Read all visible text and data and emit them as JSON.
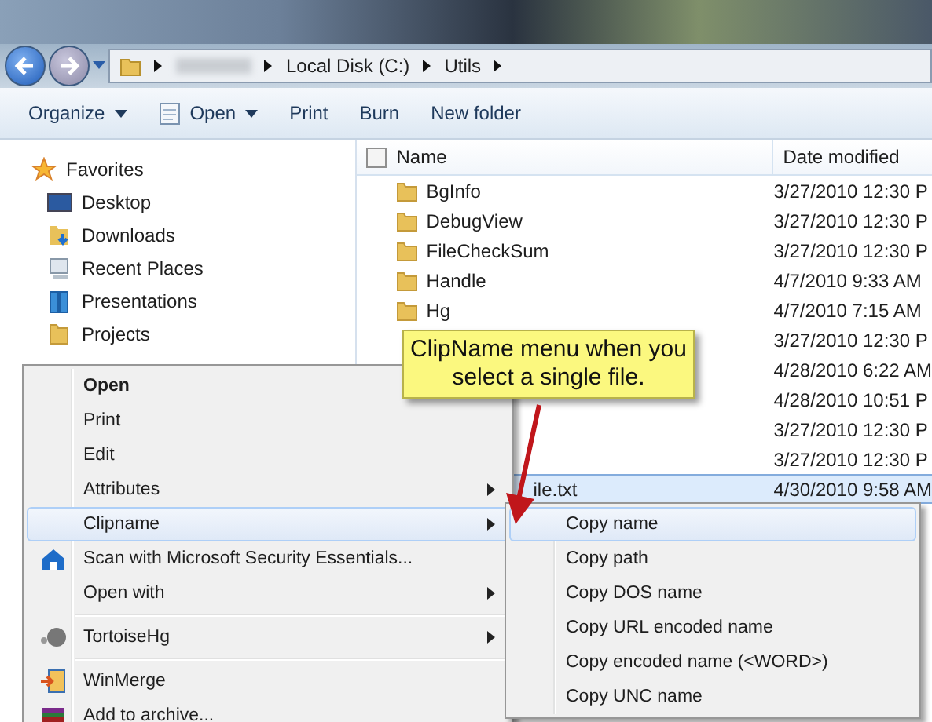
{
  "address_bar": {
    "crumbs": [
      "Local Disk (C:)",
      "Utils"
    ]
  },
  "toolbar": {
    "buttons": [
      {
        "label": "Organize",
        "dropdown": true
      },
      {
        "label": "Open",
        "dropdown": true
      },
      {
        "label": "Print",
        "dropdown": false
      },
      {
        "label": "Burn",
        "dropdown": false
      },
      {
        "label": "New folder",
        "dropdown": false
      }
    ]
  },
  "nav_pane": {
    "title": "Favorites",
    "items": [
      "Desktop",
      "Downloads",
      "Recent Places",
      "Presentations",
      "Projects"
    ]
  },
  "file_list": {
    "columns": [
      "Name",
      "Date modified"
    ],
    "select_all_checked": false,
    "rows": [
      {
        "name": "BgInfo",
        "date": "3/27/2010 12:30 P",
        "selected": false
      },
      {
        "name": "DebugView",
        "date": "3/27/2010 12:30 P",
        "selected": false
      },
      {
        "name": "FileCheckSum",
        "date": "3/27/2010 12:30 P",
        "selected": false
      },
      {
        "name": "Handle",
        "date": "4/7/2010 9:33 AM",
        "selected": false
      },
      {
        "name": "Hg",
        "date": "4/7/2010 7:15 AM",
        "selected": false
      },
      {
        "date": "3/27/2010 12:30 P",
        "selected": false
      },
      {
        "date": "4/28/2010 6:22 AM",
        "selected": false
      },
      {
        "date": "4/28/2010 10:51 P",
        "selected": false
      },
      {
        "date": "3/27/2010 12:30 P",
        "selected": false
      },
      {
        "date": "3/27/2010 12:30 P",
        "selected": false
      },
      {
        "name": "ile.txt",
        "date": "4/30/2010 9:58 AM",
        "selected": true
      }
    ]
  },
  "context_menu": {
    "items": [
      {
        "kind": "item",
        "label": "Open",
        "bold": true,
        "submenu": false,
        "selected": false
      },
      {
        "kind": "item",
        "label": "Print",
        "bold": false,
        "submenu": false,
        "selected": false
      },
      {
        "kind": "item",
        "label": "Edit",
        "bold": false,
        "submenu": false,
        "selected": false
      },
      {
        "kind": "item",
        "label": "Attributes",
        "bold": false,
        "submenu": true,
        "selected": false
      },
      {
        "kind": "item",
        "label": "Clipname",
        "bold": false,
        "submenu": true,
        "selected": true
      },
      {
        "kind": "item",
        "label": "Scan with Microsoft Security Essentials...",
        "bold": false,
        "submenu": false,
        "selected": false
      },
      {
        "kind": "item",
        "label": "Open with",
        "bold": false,
        "submenu": true,
        "selected": false
      },
      {
        "kind": "separator"
      },
      {
        "kind": "item",
        "label": "TortoiseHg",
        "bold": false,
        "submenu": true,
        "selected": false
      },
      {
        "kind": "separator"
      },
      {
        "kind": "item",
        "label": "WinMerge",
        "bold": false,
        "submenu": false,
        "selected": false
      },
      {
        "kind": "item",
        "label": "Add to archive...",
        "bold": false,
        "submenu": false,
        "selected": false
      }
    ]
  },
  "submenu": {
    "items": [
      {
        "label": "Copy name",
        "selected": true
      },
      {
        "label": "Copy path",
        "selected": false
      },
      {
        "label": "Copy DOS name",
        "selected": false
      },
      {
        "label": "Copy URL encoded name",
        "selected": false
      },
      {
        "label": "Copy encoded name (<WORD>)",
        "selected": false
      },
      {
        "label": "Copy UNC name",
        "selected": false
      }
    ]
  },
  "callout": {
    "text": "ClipName menu when you select a single file."
  }
}
